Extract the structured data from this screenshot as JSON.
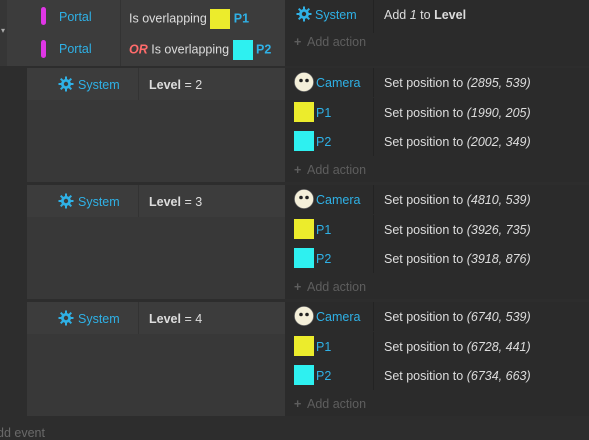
{
  "top_event": {
    "conditions": [
      {
        "object": "Portal",
        "prefix": "",
        "text": "Is overlapping",
        "target": "P1",
        "target_color": "yellow"
      },
      {
        "object": "Portal",
        "prefix": "OR",
        "text": "Is overlapping",
        "target": "P2",
        "target_color": "cyan"
      }
    ],
    "action": {
      "object": "System",
      "text_pre": "Add",
      "value": "1",
      "text_mid": "to",
      "var": "Level"
    },
    "add_action": "Add action"
  },
  "sub_events": [
    {
      "system": "System",
      "var": "Level",
      "op": "=",
      "value": "2",
      "actions": [
        {
          "object": "Camera",
          "icon": "camera-face-icon",
          "text": "Set position to",
          "coords": "(2895, 539)"
        },
        {
          "object": "P1",
          "icon": "yellow-square-icon",
          "text": "Set position to",
          "coords": "(1990, 205)"
        },
        {
          "object": "P2",
          "icon": "cyan-square-icon",
          "text": "Set position to",
          "coords": "(2002, 349)"
        }
      ],
      "add_action": "Add action"
    },
    {
      "system": "System",
      "var": "Level",
      "op": "=",
      "value": "3",
      "actions": [
        {
          "object": "Camera",
          "icon": "camera-face-icon",
          "text": "Set position to",
          "coords": "(4810, 539)"
        },
        {
          "object": "P1",
          "icon": "yellow-square-icon",
          "text": "Set position to",
          "coords": "(3926, 735)"
        },
        {
          "object": "P2",
          "icon": "cyan-square-icon",
          "text": "Set position to",
          "coords": "(3918, 876)"
        }
      ],
      "add_action": "Add action"
    },
    {
      "system": "System",
      "var": "Level",
      "op": "=",
      "value": "4",
      "actions": [
        {
          "object": "Camera",
          "icon": "camera-face-icon",
          "text": "Set position to",
          "coords": "(6740, 539)"
        },
        {
          "object": "P1",
          "icon": "yellow-square-icon",
          "text": "Set position to",
          "coords": "(6728, 441)"
        },
        {
          "object": "P2",
          "icon": "cyan-square-icon",
          "text": "Set position to",
          "coords": "(6734, 663)"
        }
      ],
      "add_action": "Add action"
    }
  ],
  "add_event": "dd event",
  "colors": {
    "accent_blue": "#2fb1e6",
    "portal_pink": "#e036e6",
    "p1_yellow": "#ecec2c",
    "p2_cyan": "#2ef0f0",
    "or_red": "#ff6b6b"
  }
}
